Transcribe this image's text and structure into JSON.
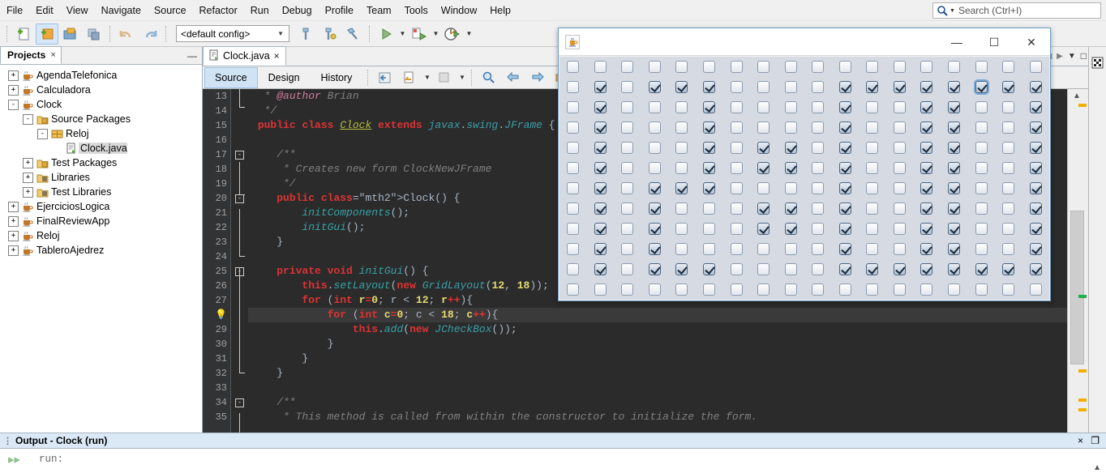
{
  "menu": {
    "items": [
      "File",
      "Edit",
      "View",
      "Navigate",
      "Source",
      "Refactor",
      "Run",
      "Debug",
      "Profile",
      "Team",
      "Tools",
      "Window",
      "Help"
    ]
  },
  "search": {
    "placeholder": "Search (Ctrl+I)",
    "icon": "search-icon"
  },
  "toolbar": {
    "config_value": "<default config>",
    "buttons": [
      "new-file",
      "new-project",
      "open-project",
      "save-all",
      "undo",
      "redo",
      "build-project",
      "clean-build",
      "run-project",
      "debug-project",
      "profile-project"
    ]
  },
  "projects": {
    "tab_label": "Projects",
    "close_label": "×",
    "minimize_label": "—",
    "tree": [
      {
        "label": "AgendaTelefonica",
        "indent": 0,
        "toggle": "+",
        "icon": "java-project-icon",
        "selected": false
      },
      {
        "label": "Calculadora",
        "indent": 0,
        "toggle": "+",
        "icon": "java-project-icon",
        "selected": false
      },
      {
        "label": "Clock",
        "indent": 0,
        "toggle": "-",
        "icon": "java-project-icon",
        "selected": false
      },
      {
        "label": "Source Packages",
        "indent": 1,
        "toggle": "-",
        "icon": "source-packages-icon",
        "selected": false
      },
      {
        "label": "Reloj",
        "indent": 2,
        "toggle": "-",
        "icon": "package-icon",
        "selected": false
      },
      {
        "label": "Clock.java",
        "indent": 3,
        "toggle": "",
        "icon": "java-file-icon",
        "selected": true
      },
      {
        "label": "Test Packages",
        "indent": 1,
        "toggle": "+",
        "icon": "test-packages-icon",
        "selected": false
      },
      {
        "label": "Libraries",
        "indent": 1,
        "toggle": "+",
        "icon": "libraries-icon",
        "selected": false
      },
      {
        "label": "Test Libraries",
        "indent": 1,
        "toggle": "+",
        "icon": "test-libraries-icon",
        "selected": false
      },
      {
        "label": "EjerciciosLogica",
        "indent": 0,
        "toggle": "+",
        "icon": "java-project-icon",
        "selected": false
      },
      {
        "label": "FinalReviewApp",
        "indent": 0,
        "toggle": "+",
        "icon": "java-project-icon",
        "selected": false
      },
      {
        "label": "Reloj",
        "indent": 0,
        "toggle": "+",
        "icon": "java-project-icon",
        "selected": false
      },
      {
        "label": "TableroAjedrez",
        "indent": 0,
        "toggle": "+",
        "icon": "java-project-icon",
        "selected": false
      }
    ]
  },
  "editor": {
    "tab_label": "Clock.java",
    "tab_close": "×",
    "view_tabs": [
      {
        "label": "Source",
        "selected": true
      },
      {
        "label": "Design",
        "selected": false
      },
      {
        "label": "History",
        "selected": false
      }
    ],
    "first_line": 13,
    "lines": [
      {
        "n": "13",
        "fold": "",
        "highlight": false
      },
      {
        "n": "14",
        "fold": "",
        "highlight": false
      },
      {
        "n": "15",
        "fold": "",
        "highlight": false
      },
      {
        "n": "16",
        "fold": "",
        "highlight": false
      },
      {
        "n": "17",
        "fold": "-",
        "highlight": false
      },
      {
        "n": "18",
        "fold": "",
        "highlight": false
      },
      {
        "n": "19",
        "fold": "",
        "highlight": false
      },
      {
        "n": "20",
        "fold": "-",
        "highlight": false
      },
      {
        "n": "21",
        "fold": "",
        "highlight": false
      },
      {
        "n": "22",
        "fold": "",
        "highlight": false
      },
      {
        "n": "23",
        "fold": "",
        "highlight": false
      },
      {
        "n": "24",
        "fold": "",
        "highlight": false
      },
      {
        "n": "25",
        "fold": "-",
        "highlight": false
      },
      {
        "n": "26",
        "fold": "",
        "highlight": false
      },
      {
        "n": "27",
        "fold": "",
        "highlight": false
      },
      {
        "n": "💡",
        "fold": "",
        "highlight": false
      },
      {
        "n": "29",
        "fold": "",
        "highlight": false
      },
      {
        "n": "30",
        "fold": "",
        "highlight": false
      },
      {
        "n": "31",
        "fold": "",
        "highlight": false
      },
      {
        "n": "32",
        "fold": "",
        "highlight": false
      },
      {
        "n": "33",
        "fold": "",
        "highlight": false
      },
      {
        "n": "34",
        "fold": "-",
        "highlight": false
      },
      {
        "n": "35",
        "fold": "",
        "highlight": false
      }
    ],
    "code_text": [
      "  * @author Brian",
      "  */",
      " public class Clock extends javax.swing.JFrame {",
      "",
      "    /**",
      "     * Creates new form ClockNewJFrame",
      "     */",
      "    public Clock() {",
      "        initComponents();",
      "        initGui();",
      "    }",
      "",
      "    private void initGui() {",
      "        this.setLayout(new GridLayout(12, 18));",
      "        for (int r=0; r < 12; r++){",
      "            for (int c=0; c < 18; c++){",
      "                this.add(new JCheckBox());",
      "            }",
      "        }",
      "    }",
      "",
      "    /**",
      "     * This method is called from within the constructor to initialize the form."
    ]
  },
  "output": {
    "title": "Output - Clock (run)",
    "close_label": "×",
    "maximize_label": "❐",
    "text": "run:"
  },
  "jwindow": {
    "title": "",
    "icon": "java-coffee-cup-icon",
    "minimize_label": "—",
    "maximize_label": "☐",
    "close_label": "✕",
    "rows": 12,
    "cols": 18,
    "focused_cell": {
      "row": 1,
      "col": 15
    },
    "checked": [
      [
        0,
        0,
        0,
        0,
        0,
        0,
        0,
        0,
        0,
        0,
        0,
        0,
        0,
        0,
        0,
        0,
        0,
        0
      ],
      [
        0,
        1,
        0,
        1,
        1,
        1,
        0,
        0,
        0,
        0,
        1,
        1,
        1,
        1,
        1,
        1,
        1,
        1
      ],
      [
        0,
        1,
        0,
        0,
        0,
        1,
        0,
        0,
        0,
        0,
        1,
        0,
        0,
        1,
        1,
        0,
        0,
        1
      ],
      [
        0,
        1,
        0,
        0,
        0,
        1,
        0,
        0,
        0,
        0,
        1,
        0,
        0,
        1,
        1,
        0,
        0,
        1
      ],
      [
        0,
        1,
        0,
        0,
        0,
        1,
        0,
        1,
        1,
        0,
        1,
        0,
        0,
        1,
        1,
        0,
        0,
        1
      ],
      [
        0,
        1,
        0,
        0,
        0,
        1,
        0,
        1,
        1,
        0,
        1,
        0,
        0,
        1,
        1,
        0,
        0,
        1
      ],
      [
        0,
        1,
        0,
        1,
        1,
        1,
        0,
        0,
        0,
        0,
        1,
        0,
        0,
        1,
        1,
        0,
        0,
        1
      ],
      [
        0,
        1,
        0,
        1,
        0,
        0,
        0,
        1,
        1,
        0,
        1,
        0,
        0,
        1,
        1,
        0,
        0,
        1
      ],
      [
        0,
        1,
        0,
        1,
        0,
        0,
        0,
        1,
        1,
        0,
        1,
        0,
        0,
        1,
        1,
        0,
        0,
        1
      ],
      [
        0,
        1,
        0,
        1,
        0,
        0,
        0,
        0,
        0,
        0,
        1,
        0,
        0,
        1,
        1,
        0,
        0,
        1
      ],
      [
        0,
        1,
        0,
        1,
        1,
        1,
        0,
        0,
        0,
        0,
        1,
        1,
        1,
        1,
        1,
        1,
        1,
        1
      ],
      [
        0,
        0,
        0,
        0,
        0,
        0,
        0,
        0,
        0,
        0,
        0,
        0,
        0,
        0,
        0,
        0,
        0,
        0
      ]
    ]
  },
  "colors": {
    "accent": "#d6e8f8",
    "editor_bg": "#2b2b2b",
    "gutter_bg": "#313335",
    "output_head": "#dbe9f7",
    "jwindow_border": "#6b9ec9"
  }
}
